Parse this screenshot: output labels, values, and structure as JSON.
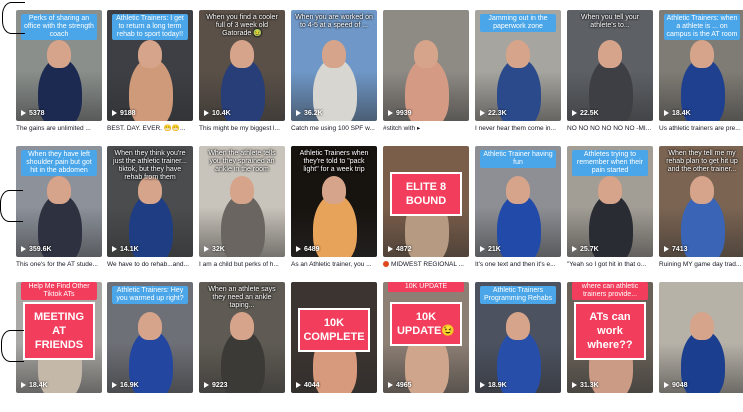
{
  "rows": [
    [
      {
        "overlay": "Perks of sharing an office with the strength coach",
        "overlay_style": "blue",
        "views": "5378",
        "caption": "The gains are unlimited ...",
        "bg": "#8a8f8c",
        "person": "#1c2a52"
      },
      {
        "overlay": "Athletic Trainers: I get to return a long term rehab to sport today!!",
        "overlay_style": "blue",
        "views": "9188",
        "caption": "BEST. DAY. EVER. 😁😁...",
        "bg": "#3d3f44",
        "person": "#cf9a7a"
      },
      {
        "overlay": "When you find a cooler full of 3 week old Gatorade 🤢",
        "overlay_style": "white",
        "views": "10.4K",
        "caption": "This might be my biggest l...",
        "bg": "#5a5048",
        "person": "#283e78"
      },
      {
        "overlay": "When you are worked on to 4-5 at a speed of ...",
        "overlay_style": "white",
        "views": "36.2K",
        "caption": "Catch me using 100 SPF w...",
        "bg": "#6f98c8",
        "person": "#d8d6d0"
      },
      {
        "overlay": "",
        "overlay_style": "none",
        "views": "9939",
        "caption": "#stitch with ▸",
        "bg": "#8e8a84",
        "person": "#d49a84"
      },
      {
        "overlay": "Jamming out in the paperwork zone",
        "overlay_style": "blue",
        "views": "22.3K",
        "caption": "I never hear them come in...",
        "bg": "#a7a59f",
        "person": "#2a4a8c"
      },
      {
        "overlay": "When you tell your athlete's to...",
        "overlay_style": "white",
        "views": "22.5K",
        "caption": "NO NO NO NO NO NO -MI...",
        "bg": "#5d6166",
        "person": "#3e3f45"
      },
      {
        "overlay": "Athletic Trainers: when a athlete is ... on campus is the AT room",
        "overlay_style": "blue",
        "views": "18.4K",
        "caption": "Us athletic trainers are pre...",
        "bg": "#7f7c75",
        "person": "#1f3f8f"
      }
    ],
    [
      {
        "overlay": "When they have left shoulder pain but got hit in the abdomen",
        "overlay_style": "blue",
        "views": "359.6K",
        "caption": "This one's for the AT stude...",
        "bg": "#8c919a",
        "person": "#2d3140"
      },
      {
        "overlay": "When they think you're just the athletic trainer... tiktok, but they have rehab from them",
        "overlay_style": "white",
        "views": "14.1K",
        "caption": "We have to do rehab...and...",
        "bg": "#4b4c4e",
        "person": "#1f3d82"
      },
      {
        "overlay": "When the athlete tells you they sprained an ankle in the room",
        "overlay_style": "white",
        "views": "32K",
        "caption": "I am a child but perks of h...",
        "bg": "#c9c4bb",
        "person": "#6a6560"
      },
      {
        "overlay": "Athletic Trainers when they're told to \"pack light\" for a week trip",
        "overlay_style": "white",
        "views": "6489",
        "caption": "As an Athletic trainer, you ...",
        "bg": "#17130f",
        "person": "#e8a35a"
      },
      {
        "overlay": "ELITE 8 BOUND",
        "overlay_style": "bigpink",
        "views": "4872",
        "caption": "MIDWEST REGIONAL ...",
        "bg": "#7a5e4a",
        "person": "#b69a82",
        "badge": true
      },
      {
        "overlay": "Athletic Trainer having fun",
        "overlay_style": "blue",
        "views": "21K",
        "caption": "It's one text and then it's e...",
        "bg": "#8d8f95",
        "person": "#224aa8"
      },
      {
        "overlay": "Athletes trying to remember when their pain started",
        "overlay_style": "blue",
        "views": "25.7K",
        "caption": "\"Yeah so I got hit in that o...",
        "bg": "#a29e96",
        "person": "#2a2c33"
      },
      {
        "overlay": "When they tell me my rehab plan to get hit up and the other trainer...",
        "overlay_style": "white",
        "views": "7413",
        "caption": "Ruining MY game day trad...",
        "bg": "#7b6452",
        "person": "#3a64b5"
      }
    ],
    [
      {
        "overlay": "MEETING AT FRIENDS",
        "overlay_style": "bigpink",
        "top_label": "Help Me Find Other Tiktok ATs",
        "views": "18.4K",
        "caption": "",
        "bg": "#a9a8a4",
        "person": "#c4b8a9"
      },
      {
        "overlay": "Athletic Trainers: Hey you warmed up right?",
        "overlay_style": "blue",
        "views": "16.9K",
        "caption": "",
        "bg": "#6e7077",
        "person": "#2346a0"
      },
      {
        "overlay": "When an athlete says they need an ankle taping...",
        "overlay_style": "white",
        "views": "9223",
        "caption": "",
        "bg": "#5f5b54",
        "person": "#3b3a36"
      },
      {
        "overlay": "10K COMPLETE",
        "overlay_style": "bigpink",
        "views": "4044",
        "caption": "",
        "bg": "#3c3430",
        "person": "#d79a7c"
      },
      {
        "overlay": "10K UPDATE😉",
        "overlay_style": "bigpink",
        "top_label": "10K UPDATE",
        "views": "4965",
        "caption": "",
        "bg": "#8d7f74",
        "person": "#cfa58c"
      },
      {
        "overlay": "Athletic Trainers Programming Rehabs",
        "overlay_style": "blue",
        "views": "18.9K",
        "caption": "",
        "bg": "#4c5260",
        "person": "#274ea8"
      },
      {
        "overlay": "ATs can work where??",
        "overlay_style": "bigpink",
        "top_label": "where can athletic trainers provide...",
        "views": "31.3K",
        "caption": "",
        "bg": "#6a6259",
        "person": "#cc9b86"
      },
      {
        "overlay": "",
        "overlay_style": "none",
        "views": "9048",
        "caption": "",
        "bg": "#b7b2a8",
        "person": "#1b3e8e"
      }
    ]
  ]
}
